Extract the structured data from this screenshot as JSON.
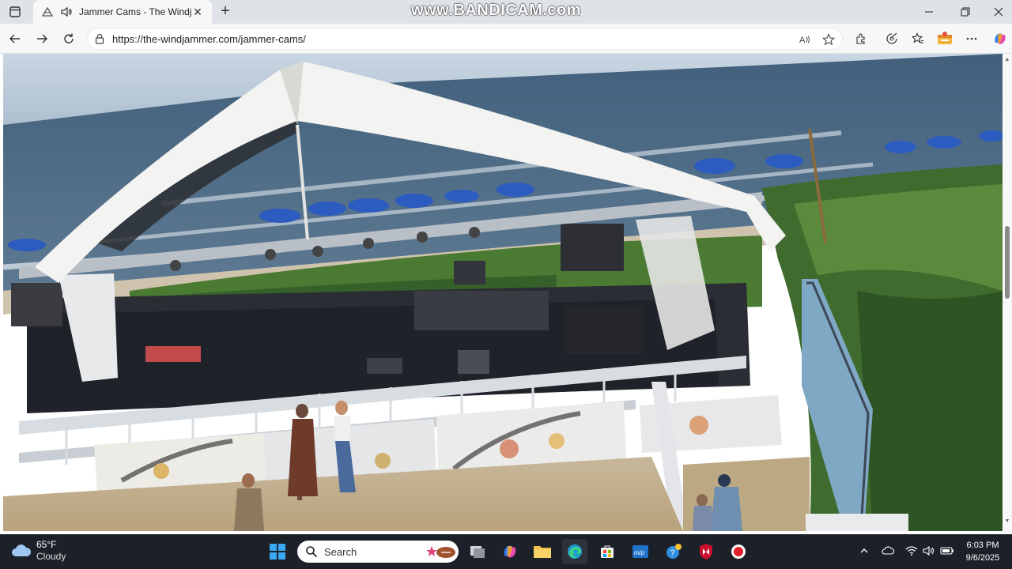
{
  "browser": {
    "tab": {
      "title": "Jammer Cams - The Windjammer",
      "close_label": "✕"
    },
    "new_tab_label": "+",
    "address": {
      "url": "https://the-windjammer.com/jammer-cams/"
    },
    "window_controls": {
      "minimize": "—",
      "maximize": "▢",
      "close": "✕"
    }
  },
  "watermark": {
    "text": "www.BANDICAM.com"
  },
  "webcam": {
    "description_icon": "beach-stage-live-camera-image"
  },
  "taskbar": {
    "weather": {
      "temp": "65°F",
      "condition": "Cloudy"
    },
    "search_placeholder": "Search",
    "clock": {
      "time": "6:03 PM",
      "date": "9/6/2025"
    }
  },
  "colors": {
    "taskbar_bg": "#1c2028",
    "tab_active": "#f7f7f7",
    "tabbar_bg": "#dfe3e8",
    "accent": "#0078d4"
  }
}
